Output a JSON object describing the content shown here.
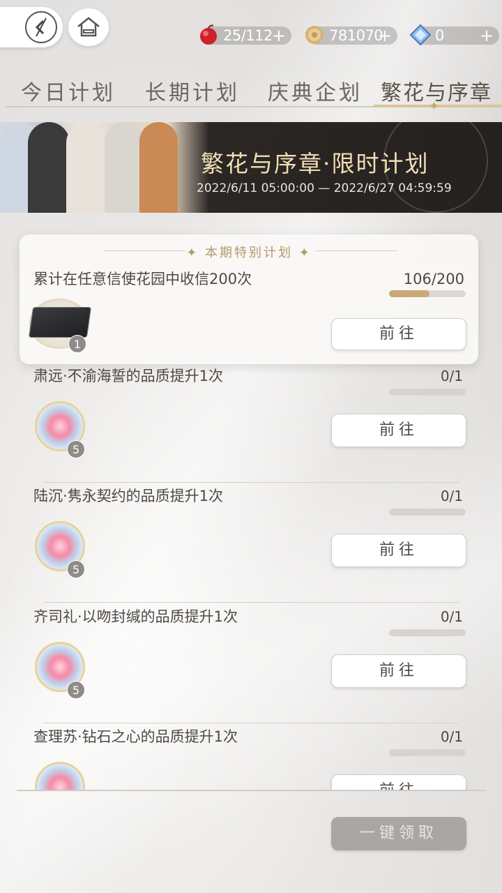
{
  "currencies": [
    {
      "name": "apple",
      "value": "25/112",
      "plus": "+",
      "icon": "apple-icon",
      "color": "#d0202c"
    },
    {
      "name": "coin",
      "value": "781070",
      "plus": "+",
      "icon": "coin-icon",
      "color": "#d6b274"
    },
    {
      "name": "diamond",
      "value": "0",
      "plus": "+",
      "icon": "diamond-icon",
      "color": "#6fa4e0"
    }
  ],
  "tabs": [
    {
      "label": "今日计划"
    },
    {
      "label": "长期计划"
    },
    {
      "label": "庆典企划"
    },
    {
      "label": "繁花与序章"
    }
  ],
  "banner": {
    "title": "繁花与序章·限时计划",
    "date_range": "2022/6/11 05:00:00 — 2022/6/27 04:59:59"
  },
  "special": {
    "header": "本期特别计划",
    "title": "累计在任意信使花园中收信200次",
    "progress": "106/200",
    "progress_fraction": 0.53,
    "reward_count": "1",
    "button": "前往"
  },
  "tasks": [
    {
      "title": "肃远·不渝海誓的品质提升1次",
      "progress": "0/1",
      "reward_count": "5",
      "button": "前往"
    },
    {
      "title": "陆沉·隽永契约的品质提升1次",
      "progress": "0/1",
      "reward_count": "5",
      "button": "前往"
    },
    {
      "title": "齐司礼·以吻封缄的品质提升1次",
      "progress": "0/1",
      "reward_count": "5",
      "button": "前往"
    },
    {
      "title": "查理苏·钻石之心的品质提升1次",
      "progress": "0/1",
      "reward_count": "",
      "button": "前往"
    }
  ],
  "claim_all": "一键领取",
  "colors": {
    "accent_gold": "#c9a978",
    "banner_title": "#f1dfb4"
  }
}
